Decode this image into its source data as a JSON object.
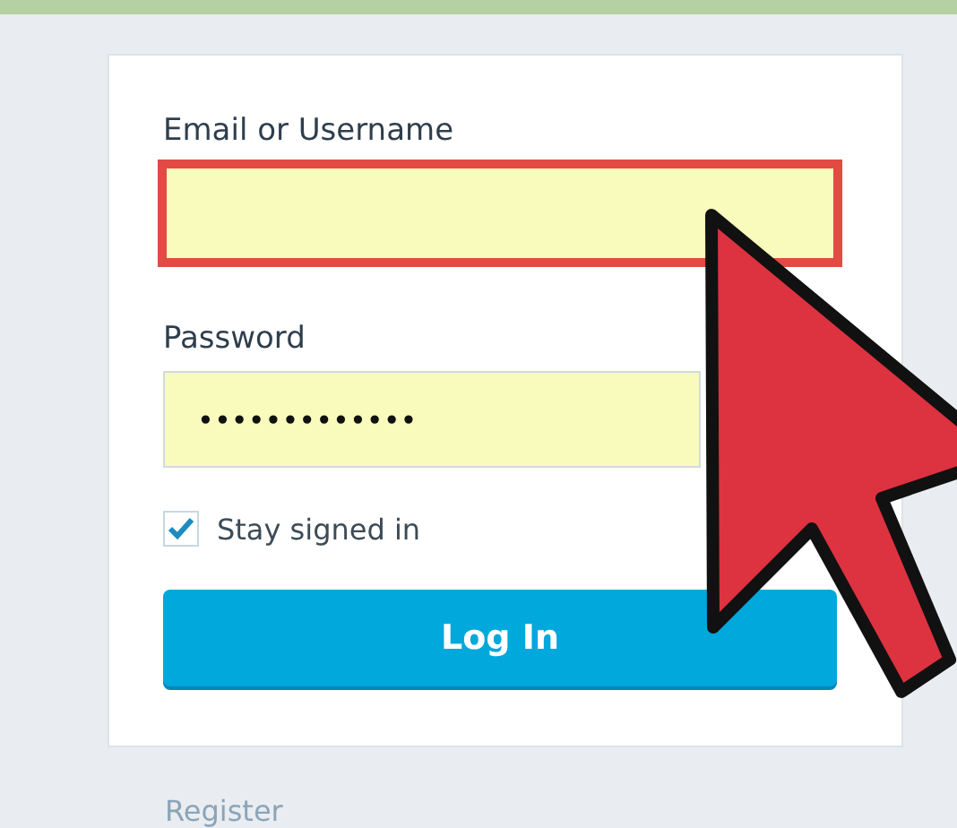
{
  "email": {
    "label": "Email or Username",
    "highlighted": true
  },
  "password": {
    "label": "Password",
    "value": "•••••••••••••"
  },
  "stay_signed_in": {
    "label": "Stay signed in",
    "checked": true
  },
  "login_button": "Log In",
  "register_link": "Register"
}
